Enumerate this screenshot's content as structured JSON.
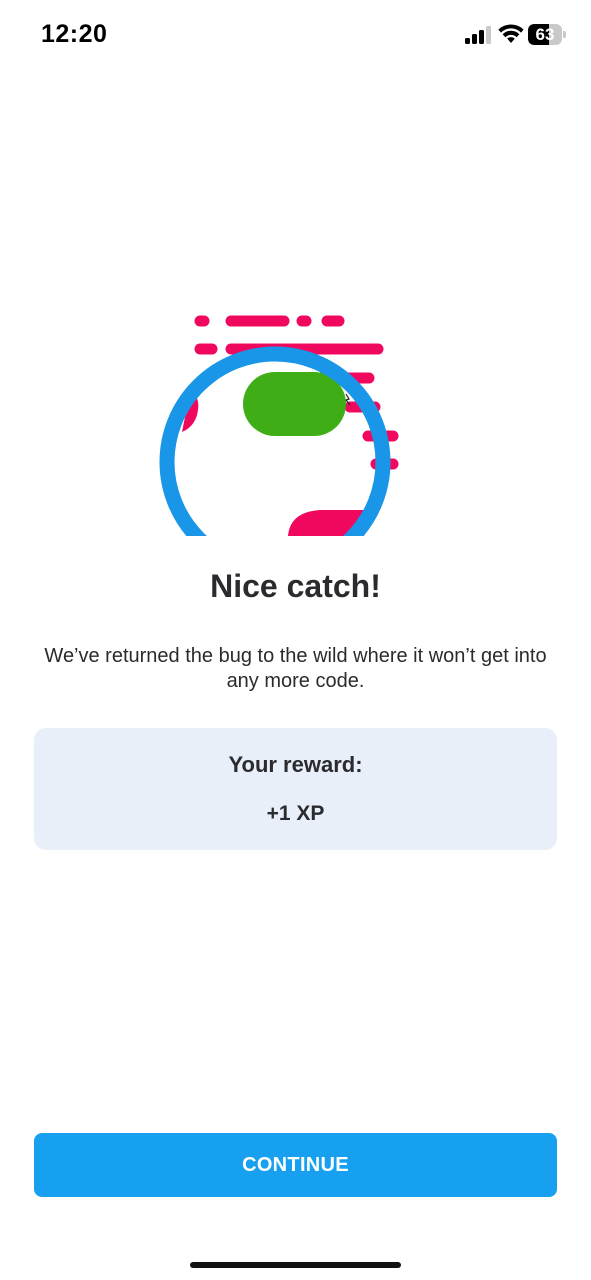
{
  "status_bar": {
    "time": "12:20",
    "battery_level": "63",
    "battery_fraction": 0.63,
    "icons": [
      "signal-icon",
      "wifi-icon",
      "battery-icon"
    ]
  },
  "illustration": {
    "icon": "caught-bug-illustration",
    "colors": {
      "ring": "#1a96e8",
      "bug": "#3fae16",
      "lines": "#f0085f"
    }
  },
  "content": {
    "title": "Nice catch!",
    "message": "We’ve returned the bug to the wild where it won’t get into any more code."
  },
  "reward": {
    "label": "Your reward:",
    "value": "+1 XP"
  },
  "actions": {
    "continue_label": "CONTINUE"
  },
  "colors": {
    "accent": "#16a0ef",
    "card_background": "#e8eff9",
    "text": "#2b2b2f"
  }
}
